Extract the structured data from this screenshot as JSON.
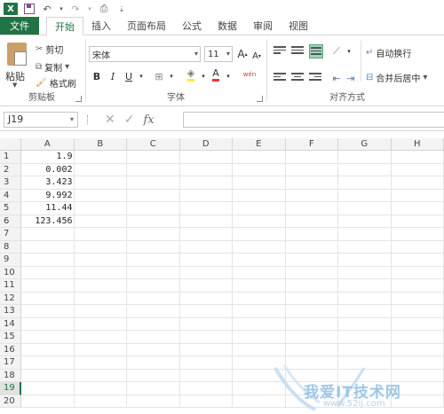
{
  "qat": {
    "app_icon_letter": "X"
  },
  "tabs": [
    {
      "label": "文件"
    },
    {
      "label": "开始"
    },
    {
      "label": "插入"
    },
    {
      "label": "页面布局"
    },
    {
      "label": "公式"
    },
    {
      "label": "数据"
    },
    {
      "label": "审阅"
    },
    {
      "label": "视图"
    }
  ],
  "ribbon": {
    "clipboard": {
      "paste_label": "粘贴",
      "cut_label": "剪切",
      "copy_label": "复制",
      "format_painter_label": "格式刷",
      "group_label": "剪贴板"
    },
    "font": {
      "font_name": "宋体",
      "font_size": "11",
      "grow_label": "A",
      "shrink_label": "A",
      "bold_label": "B",
      "italic_label": "I",
      "underline_label": "U",
      "font_color_label": "A",
      "phonetic_label": "wén",
      "group_label": "字体"
    },
    "alignment": {
      "wrap_label": "自动换行",
      "merge_label": "合并后居中",
      "group_label": "对齐方式"
    },
    "accent_color": "#217346"
  },
  "formula_bar": {
    "name_box": "J19",
    "fx_label": "fx",
    "formula_value": ""
  },
  "sheet": {
    "columns": [
      "A",
      "B",
      "C",
      "D",
      "E",
      "F",
      "G",
      "H"
    ],
    "rows": [
      "1",
      "2",
      "3",
      "4",
      "5",
      "6",
      "7",
      "8",
      "9",
      "10",
      "11",
      "12",
      "13",
      "14",
      "15",
      "16",
      "17",
      "18",
      "19",
      "20"
    ],
    "values_col_a": [
      "1.9",
      "0.002",
      "3.423",
      "9.992",
      "11.44",
      "123.456"
    ],
    "selected_row": "19"
  },
  "watermark": {
    "text": "我爱IT技术网",
    "url": "www.52ij.com"
  }
}
